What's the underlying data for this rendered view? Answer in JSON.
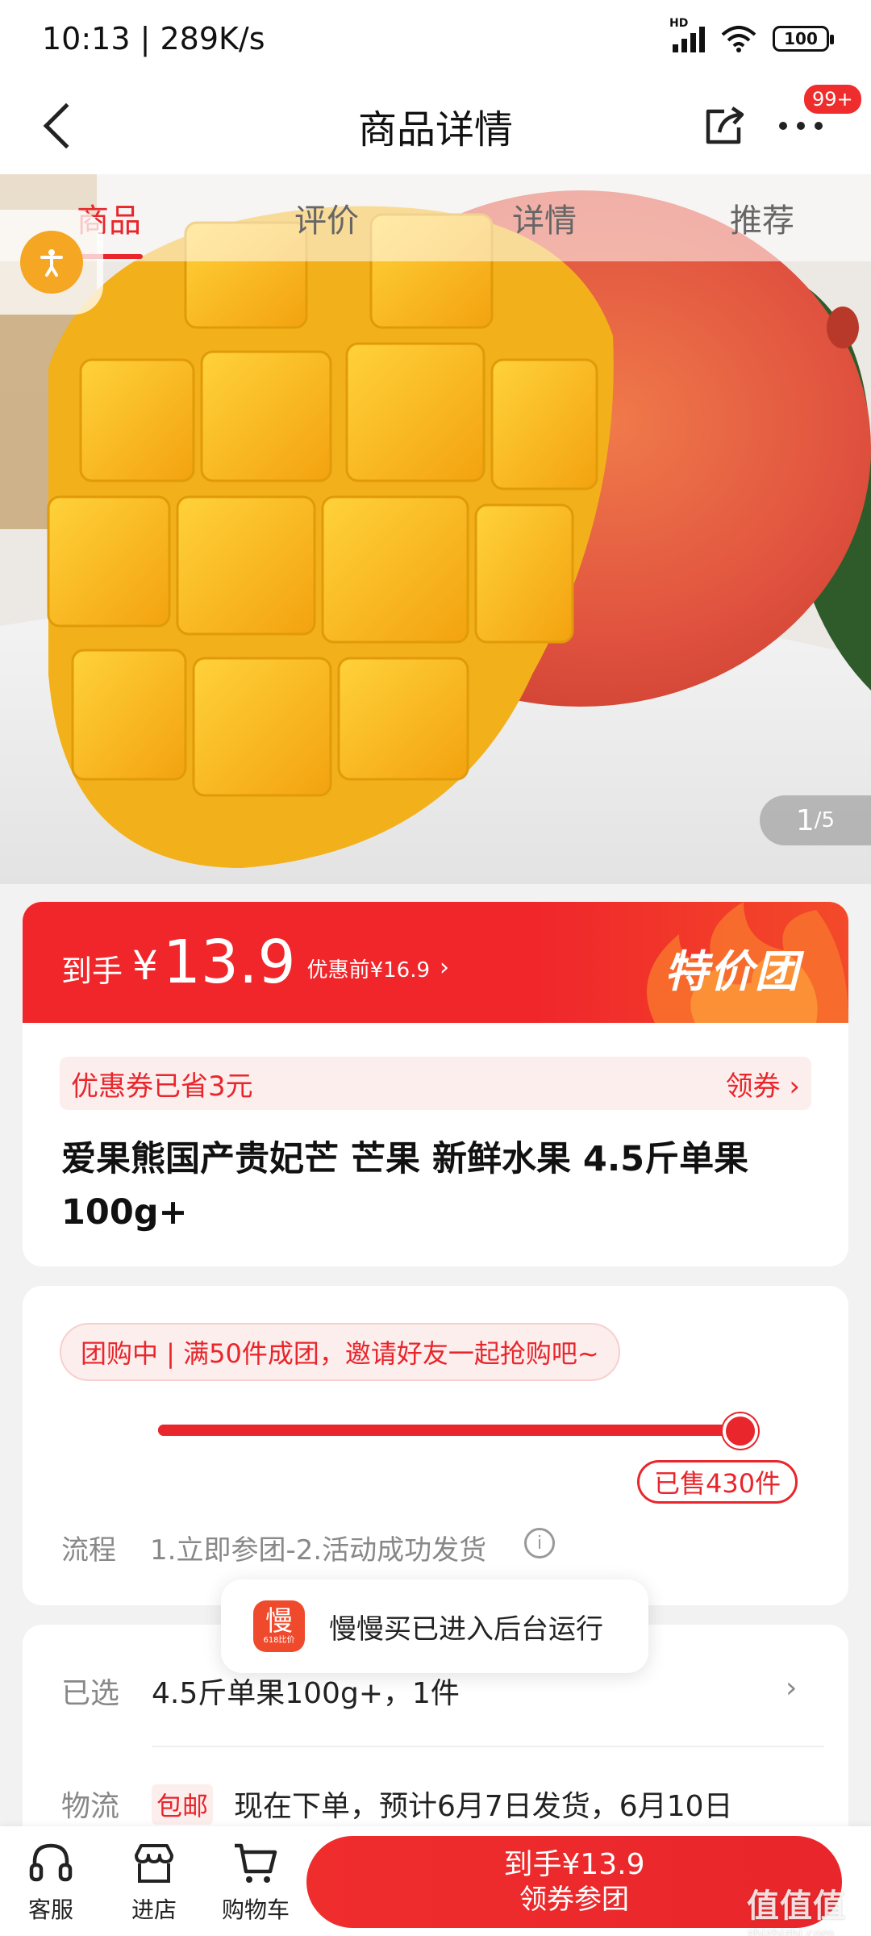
{
  "status_bar": {
    "time": "10:13 | 289K/s",
    "battery": "100"
  },
  "header": {
    "title": "商品详情",
    "badge": "99+"
  },
  "tabs": [
    {
      "label": "商品"
    },
    {
      "label": "评价"
    },
    {
      "label": "详情"
    },
    {
      "label": "推荐"
    }
  ],
  "gallery": {
    "current": "1",
    "total": "/5"
  },
  "price": {
    "prefix": "到手",
    "currency": "¥",
    "value": "13.9",
    "original": "优惠前¥16.9",
    "tag": "特价团"
  },
  "coupon": {
    "saved": "优惠券已省3元",
    "action": "领券"
  },
  "product": {
    "title": "爱果熊国产贵妃芒 芒果 新鲜水果 4.5斤单果100g+"
  },
  "group": {
    "status": "团购中 | 满50件成团，邀请好友一起抢购吧~",
    "sold": "已售430件",
    "progress": 1.0,
    "flow_label": "流程",
    "flow_steps": "1.立即参团-2.活动成功发货"
  },
  "selection": {
    "label": "已选",
    "value": "4.5斤单果100g+，1件",
    "shipping_label": "物流",
    "shipping_tag": "包邮",
    "shipping_text": "现在下单，预计6月7日发货，6月10日"
  },
  "toast": {
    "text": "慢慢买已进入后台运行",
    "icon_char": "慢",
    "icon_sub": "618比价"
  },
  "bottom_bar": {
    "service": "客服",
    "store": "进店",
    "cart": "购物车",
    "buy_price": "到手¥13.9",
    "buy_label": "领券参团"
  },
  "watermark": {
    "text": "值值值",
    "sub": "zhizhizhi.com"
  },
  "colors": {
    "accent": "#e8262b",
    "mango_yellow": "#f5b21b",
    "mango_red": "#e0523f"
  }
}
